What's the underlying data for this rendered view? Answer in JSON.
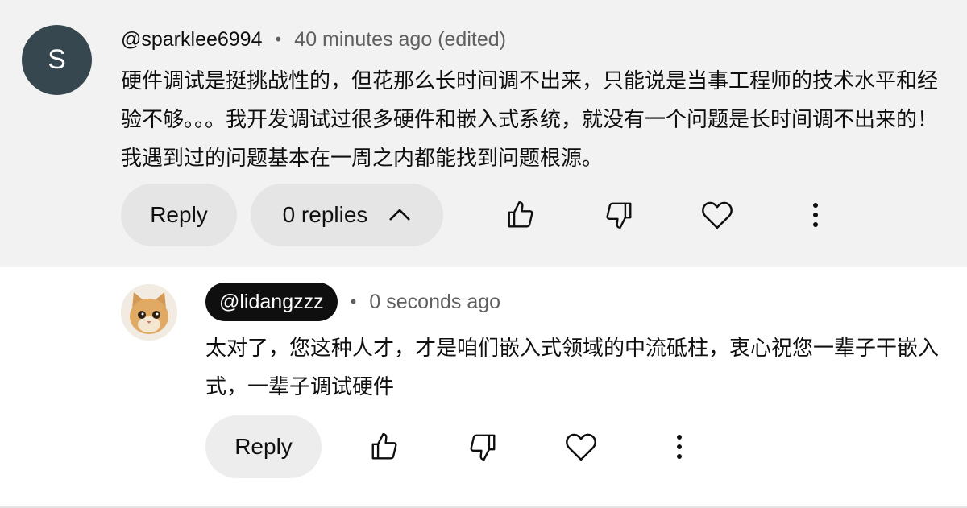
{
  "top_comment": {
    "avatar_letter": "S",
    "handle": "@sparklee6994",
    "separator": "•",
    "time": "40 minutes ago (edited)",
    "text": "硬件调试是挺挑战性的，但花那么长时间调不出来，只能说是当事工程师的技术水平和经验不够。。。我开发调试过很多硬件和嵌入式系统，就没有一个问题是长时间调不出来的！我遇到过的问题基本在一周之内都能找到问题根源。",
    "reply_label": "Reply",
    "replies_label": "0 replies",
    "icons": [
      "like-icon",
      "dislike-icon",
      "heart-icon",
      "more-vertical-icon"
    ]
  },
  "reply_comment": {
    "avatar": "cat-avatar",
    "handle": "@lidangzzz",
    "separator": "•",
    "time": "0 seconds ago",
    "text": "太对了，您这种人才，才是咱们嵌入式领域的中流砥柱，衷心祝您一辈子干嵌入式，一辈子调试硬件",
    "reply_label": "Reply",
    "icons": [
      "like-icon",
      "dislike-icon",
      "heart-icon",
      "more-vertical-icon"
    ]
  }
}
